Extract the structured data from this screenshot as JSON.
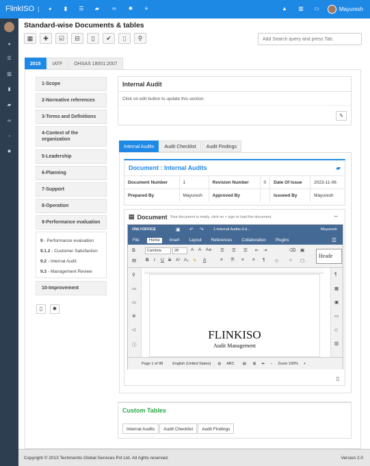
{
  "app": {
    "brand": "FlinkISO",
    "user": "Mayuresh"
  },
  "page": {
    "title": "Standard-wise Documents & tables",
    "search_placeholder": "Add Search query and press Tab."
  },
  "standards_tabs": [
    "2015",
    "IATF",
    "OHSAS 18001:2007"
  ],
  "left_nav": [
    "1-Scope",
    "2-Normative references",
    "3-Terms and Definitions",
    "4-Context of the organization",
    "5-Leadership",
    "6-Planning",
    "7-Support",
    "8-Operation",
    "9-Performance evaluation",
    "10-Improvement"
  ],
  "sub_nav": [
    {
      "num": "9",
      "label": " - Performance evaluation"
    },
    {
      "num": "9.1.2",
      "label": " - Customer Satisfaction"
    },
    {
      "num": "9.2",
      "label": " - Internal Audit"
    },
    {
      "num": "9.3",
      "label": " - Management Review"
    }
  ],
  "internal_audit": {
    "title": "Internal Audit",
    "hint": "Click on edit button to update this section."
  },
  "section_tabs": [
    "Internal Audits",
    "Audit Checklist",
    "Audit Findings"
  ],
  "document_info": {
    "title": "Document : Internal Audits",
    "labels": {
      "number": "Document Number",
      "revision": "Revision Number",
      "issue": "Date Of Issue",
      "prepared": "Prepared By",
      "approved": "Approved By",
      "issued": "Issueed By"
    },
    "values": {
      "number": "1",
      "revision": "0",
      "issue": "2023-11-06",
      "prepared": "Mayuresh",
      "approved": "",
      "issued": "Mayuresh"
    }
  },
  "doc_viewer": {
    "title": "Document",
    "note": "Your document is ready, click on + sign to load the document.",
    "onlyoffice": {
      "brand": "ONLYOFFICE",
      "file": "1-Internal Audits-0.d...",
      "user": "Mayuresh",
      "menu": [
        "File",
        "Home",
        "Insert",
        "Layout",
        "References",
        "Collaboration",
        "Plugins"
      ],
      "font": "Cambria",
      "size": "28",
      "style_preview": "Heade",
      "body_title": "FLINKISO",
      "body_sub": "Audit Management",
      "status": {
        "page": "Page 1 of 98",
        "lang": "English (United States)",
        "zoom": "Zoom 100%"
      }
    }
  },
  "custom_tables": {
    "title": "Custom Tables",
    "tabs": [
      "Internal Audits",
      "Audit Checklist",
      "Audit Findings"
    ]
  },
  "footer": {
    "copy": "Copyright © 2013 Techmentis Global Services Pvt Ltd. All rights reserved.",
    "version": "Version 2.0"
  },
  "colors": {
    "primary": "#1e88e5",
    "sidebar": "#2c3e50",
    "success": "#28a745",
    "onlyoffice": "#446995"
  }
}
